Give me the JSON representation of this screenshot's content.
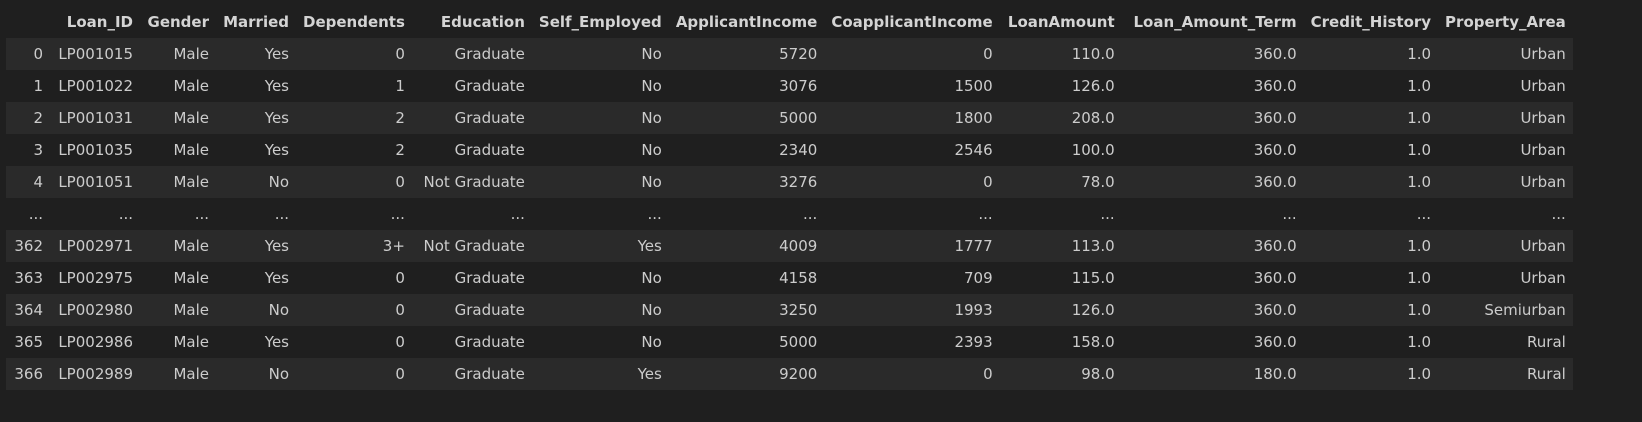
{
  "dataframe": {
    "columns": [
      "",
      "Loan_ID",
      "Gender",
      "Married",
      "Dependents",
      "Education",
      "Self_Employed",
      "ApplicantIncome",
      "CoapplicantIncome",
      "LoanAmount",
      "Loan_Amount_Term",
      "Credit_History",
      "Property_Area"
    ],
    "rows": [
      [
        "0",
        "LP001015",
        "Male",
        "Yes",
        "0",
        "Graduate",
        "No",
        "5720",
        "0",
        "110.0",
        "360.0",
        "1.0",
        "Urban"
      ],
      [
        "1",
        "LP001022",
        "Male",
        "Yes",
        "1",
        "Graduate",
        "No",
        "3076",
        "1500",
        "126.0",
        "360.0",
        "1.0",
        "Urban"
      ],
      [
        "2",
        "LP001031",
        "Male",
        "Yes",
        "2",
        "Graduate",
        "No",
        "5000",
        "1800",
        "208.0",
        "360.0",
        "1.0",
        "Urban"
      ],
      [
        "3",
        "LP001035",
        "Male",
        "Yes",
        "2",
        "Graduate",
        "No",
        "2340",
        "2546",
        "100.0",
        "360.0",
        "1.0",
        "Urban"
      ],
      [
        "4",
        "LP001051",
        "Male",
        "No",
        "0",
        "Not Graduate",
        "No",
        "3276",
        "0",
        "78.0",
        "360.0",
        "1.0",
        "Urban"
      ],
      [
        "...",
        "...",
        "...",
        "...",
        "...",
        "...",
        "...",
        "...",
        "...",
        "...",
        "...",
        "...",
        "..."
      ],
      [
        "362",
        "LP002971",
        "Male",
        "Yes",
        "3+",
        "Not Graduate",
        "Yes",
        "4009",
        "1777",
        "113.0",
        "360.0",
        "1.0",
        "Urban"
      ],
      [
        "363",
        "LP002975",
        "Male",
        "Yes",
        "0",
        "Graduate",
        "No",
        "4158",
        "709",
        "115.0",
        "360.0",
        "1.0",
        "Urban"
      ],
      [
        "364",
        "LP002980",
        "Male",
        "No",
        "0",
        "Graduate",
        "No",
        "3250",
        "1993",
        "126.0",
        "360.0",
        "1.0",
        "Semiurban"
      ],
      [
        "365",
        "LP002986",
        "Male",
        "Yes",
        "0",
        "Graduate",
        "No",
        "5000",
        "2393",
        "158.0",
        "360.0",
        "1.0",
        "Rural"
      ],
      [
        "366",
        "LP002989",
        "Male",
        "No",
        "0",
        "Graduate",
        "Yes",
        "9200",
        "0",
        "98.0",
        "180.0",
        "1.0",
        "Rural"
      ]
    ]
  }
}
